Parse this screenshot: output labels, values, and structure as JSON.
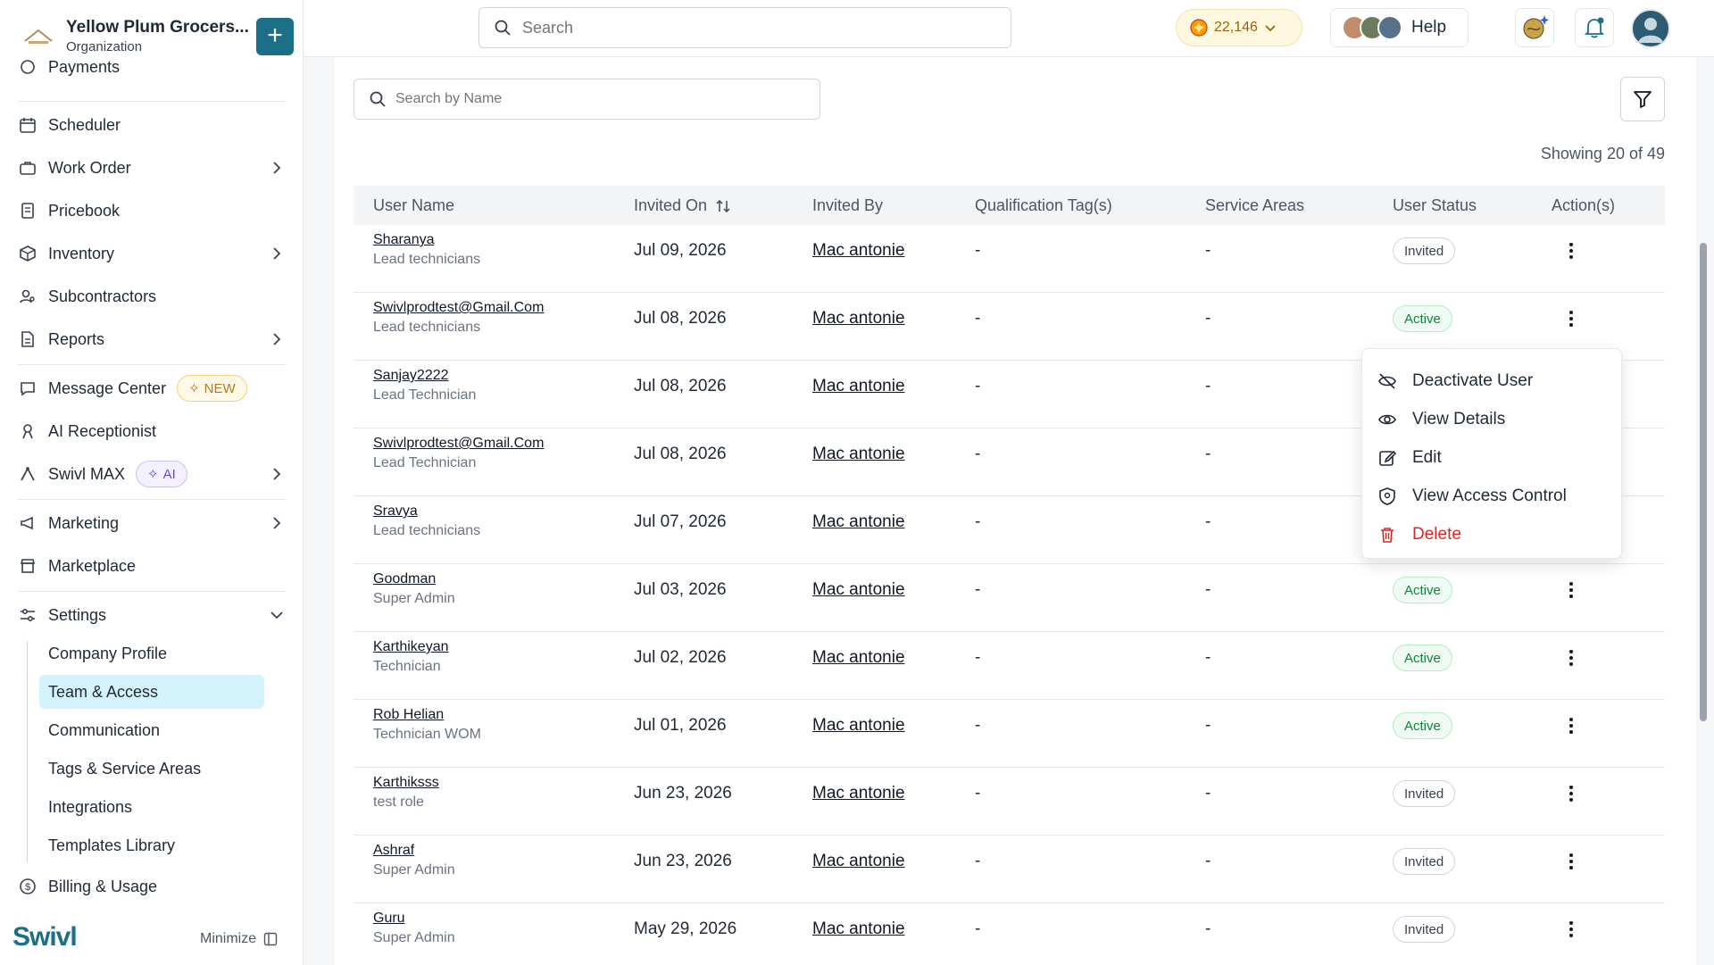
{
  "org": {
    "name": "Yellow Plum Grocers...",
    "type": "Organization",
    "add_label": "+"
  },
  "header": {
    "search_placeholder": "Search",
    "coins": "22,146",
    "help_label": "Help"
  },
  "nav": {
    "payments": "Payments",
    "scheduler": "Scheduler",
    "work_order": "Work Order",
    "pricebook": "Pricebook",
    "inventory": "Inventory",
    "subcontractors": "Subcontractors",
    "reports": "Reports",
    "message_center": "Message Center",
    "message_center_badge": "NEW",
    "ai_receptionist": "AI Receptionist",
    "swivl_max": "Swivl MAX",
    "swivl_max_badge": "AI",
    "marketing": "Marketing",
    "marketplace": "Marketplace",
    "settings": "Settings",
    "billing": "Billing & Usage"
  },
  "settings_sub": [
    "Company Profile",
    "Team & Access",
    "Communication",
    "Tags & Service Areas",
    "Integrations",
    "Templates Library"
  ],
  "brand": "Swivl",
  "minimize_label": "Minimize",
  "main": {
    "name_search_placeholder": "Search by Name",
    "showing": "Showing 20 of 49"
  },
  "table": {
    "headers": {
      "user_name": "User Name",
      "invited_on": "Invited On",
      "invited_by": "Invited By",
      "qualification": "Qualification Tag(s)",
      "service_areas": "Service Areas",
      "user_status": "User Status",
      "actions": "Action(s)"
    },
    "rows": [
      {
        "name": "Sharanya",
        "role": "Lead technicians",
        "date": "Jul 09, 2026",
        "by": "Mac antonie",
        "q": "-",
        "sa": "-",
        "status": "Invited"
      },
      {
        "name": "Swivlprodtest@Gmail.Com",
        "role": "Lead technicians",
        "date": "Jul 08, 2026",
        "by": "Mac antonie",
        "q": "-",
        "sa": "-",
        "status": "Active"
      },
      {
        "name": "Sanjay2222",
        "role": "Lead Technician",
        "date": "Jul 08, 2026",
        "by": "Mac antonie",
        "q": "-",
        "sa": "-",
        "status": ""
      },
      {
        "name": "Swivlprodtest@Gmail.Com",
        "role": "Lead Technician",
        "date": "Jul 08, 2026",
        "by": "Mac antonie",
        "q": "-",
        "sa": "-",
        "status": ""
      },
      {
        "name": "Sravya",
        "role": "Lead technicians",
        "date": "Jul 07, 2026",
        "by": "Mac antonie",
        "q": "-",
        "sa": "-",
        "status": ""
      },
      {
        "name": "Goodman",
        "role": "Super Admin",
        "date": "Jul 03, 2026",
        "by": "Mac antonie",
        "q": "-",
        "sa": "-",
        "status": "Active"
      },
      {
        "name": "Karthikeyan",
        "role": "Technician",
        "date": "Jul 02, 2026",
        "by": "Mac antonie",
        "q": "-",
        "sa": "-",
        "status": "Active"
      },
      {
        "name": "Rob Helian",
        "role": "Technician WOM",
        "date": "Jul 01, 2026",
        "by": "Mac antonie",
        "q": "-",
        "sa": "-",
        "status": "Active"
      },
      {
        "name": "Karthiksss",
        "role": "test role",
        "date": "Jun 23, 2026",
        "by": "Mac antonie",
        "q": "-",
        "sa": "-",
        "status": "Invited"
      },
      {
        "name": "Ashraf",
        "role": "Super Admin",
        "date": "Jun 23, 2026",
        "by": "Mac antonie",
        "q": "-",
        "sa": "-",
        "status": "Invited"
      },
      {
        "name": "Guru",
        "role": "Super Admin",
        "date": "May 29, 2026",
        "by": "Mac antonie",
        "q": "-",
        "sa": "-",
        "status": "Invited"
      }
    ]
  },
  "context_menu": {
    "deactivate": "Deactivate User",
    "view_details": "View Details",
    "edit": "Edit",
    "access_control": "View Access Control",
    "delete": "Delete"
  },
  "colors": {
    "accent": "#1b6f86",
    "active_nav": "#d4f2fb",
    "danger": "#dc2626",
    "active_status": "#15803d"
  }
}
